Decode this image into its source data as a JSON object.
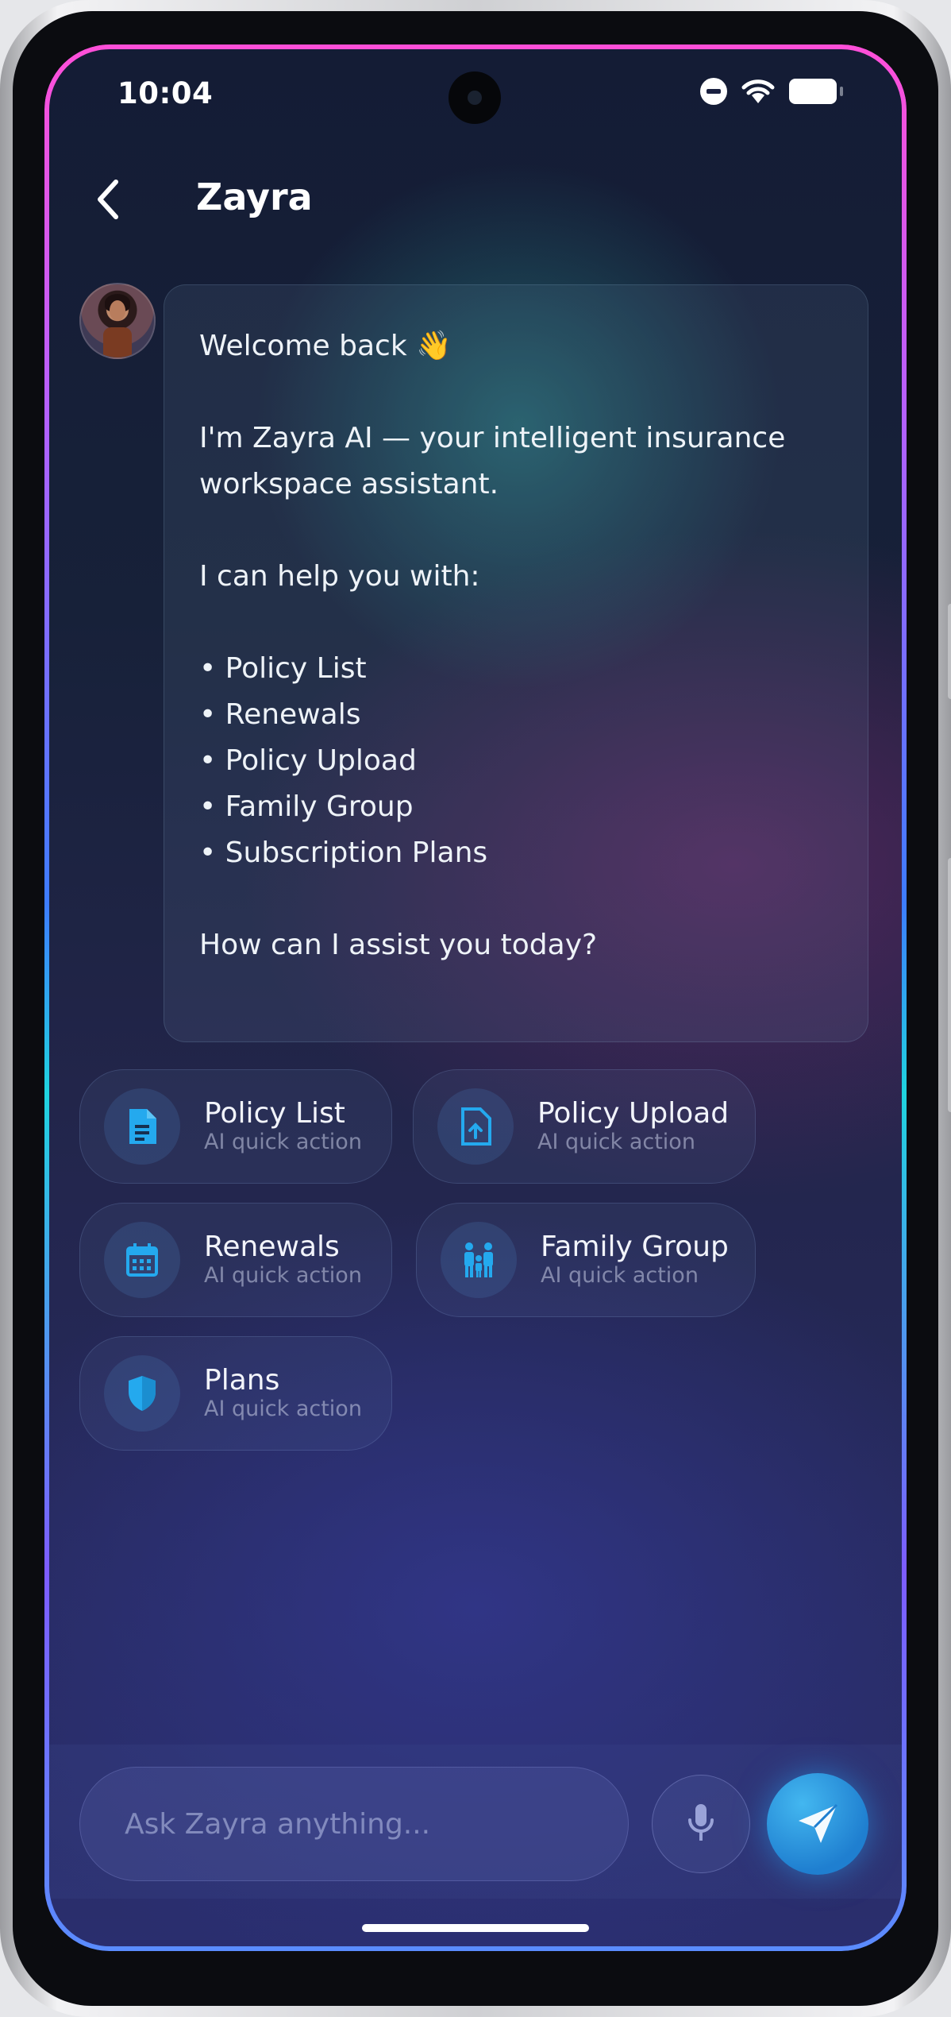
{
  "status_bar": {
    "time": "10:04",
    "icons": [
      "do-not-disturb-icon",
      "wifi-icon",
      "battery-icon"
    ]
  },
  "header": {
    "back_icon": "chevron-left-icon",
    "title": "Zayra"
  },
  "assistant_message": {
    "avatar": "assistant-avatar",
    "greeting": "Welcome back 👋",
    "intro_line1": "I'm Zayra AI — your intelligent insurance",
    "intro_line2": "workspace assistant.",
    "help_intro": "I can help you with:",
    "items": [
      "• Policy List",
      "• Renewals",
      "• Policy Upload",
      "• Family Group",
      "• Subscription Plans"
    ],
    "closing": "How can I assist you today?"
  },
  "quick_actions": [
    {
      "label": "Policy List",
      "sub": "AI quick action",
      "icon": "document-icon"
    },
    {
      "label": "Policy Upload",
      "sub": "AI quick action",
      "icon": "file-upload-icon"
    },
    {
      "label": "Renewals",
      "sub": "AI quick action",
      "icon": "calendar-icon"
    },
    {
      "label": "Family Group",
      "sub": "AI quick action",
      "icon": "family-icon"
    },
    {
      "label": "Plans",
      "sub": "AI quick action",
      "icon": "shield-icon"
    }
  ],
  "composer": {
    "placeholder": "Ask Zayra anything...",
    "mic_icon": "microphone-icon",
    "send_icon": "send-icon"
  },
  "colors": {
    "accent": "#2d9fe6",
    "icon_blue": "#24a9ee",
    "text": "#eef3f8"
  }
}
